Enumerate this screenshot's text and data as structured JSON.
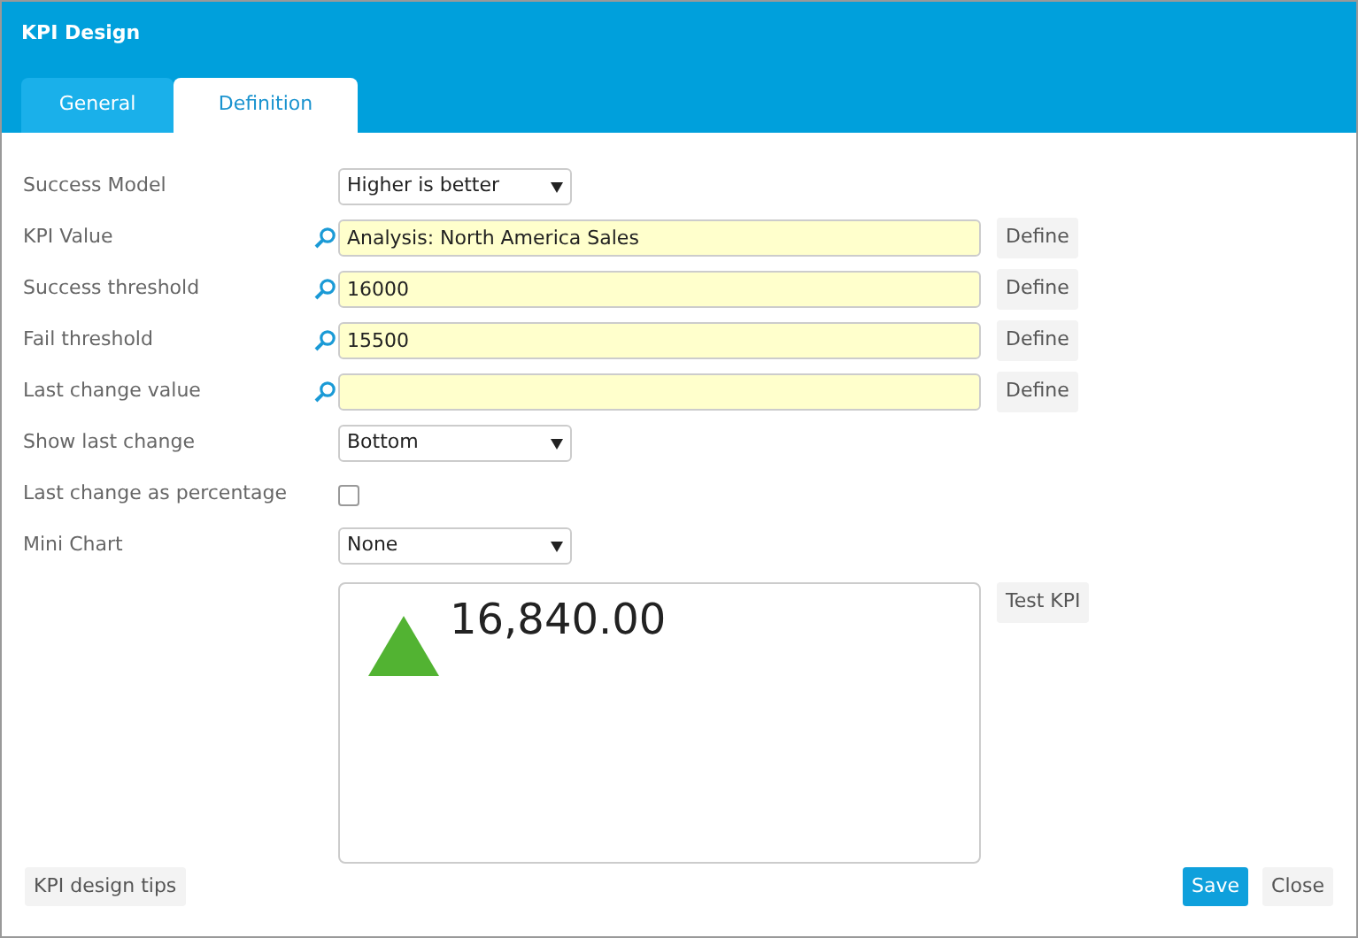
{
  "window": {
    "title": "KPI Design"
  },
  "tabs": [
    {
      "label": "General",
      "selected": false
    },
    {
      "label": "Definition",
      "selected": true
    }
  ],
  "fields": [
    {
      "kind": "select",
      "label": "Success Model",
      "value": "Higher is better"
    },
    {
      "kind": "lookup",
      "label": "KPI Value",
      "value": "Analysis: North America Sales",
      "button": "Define"
    },
    {
      "kind": "lookup",
      "label": "Success threshold",
      "value": "16000",
      "button": "Define"
    },
    {
      "kind": "lookup",
      "label": "Fail threshold",
      "value": "15500",
      "button": "Define"
    },
    {
      "kind": "lookup",
      "label": "Last change value",
      "button": "Define"
    },
    {
      "kind": "select",
      "label": "Show last change",
      "value": "Bottom"
    },
    {
      "kind": "checkbox",
      "label": "Last change as percentage",
      "checked": false
    },
    {
      "kind": "select",
      "label": "Mini Chart",
      "value": "None"
    }
  ],
  "preview": {
    "value": "16,840.00",
    "color": "#52b332",
    "button": "Test KPI"
  },
  "footer": {
    "tips": "KPI design tips",
    "buttons": [
      {
        "label": "Save",
        "kind": "primary"
      },
      {
        "label": "Close",
        "kind": "plain"
      }
    ]
  }
}
